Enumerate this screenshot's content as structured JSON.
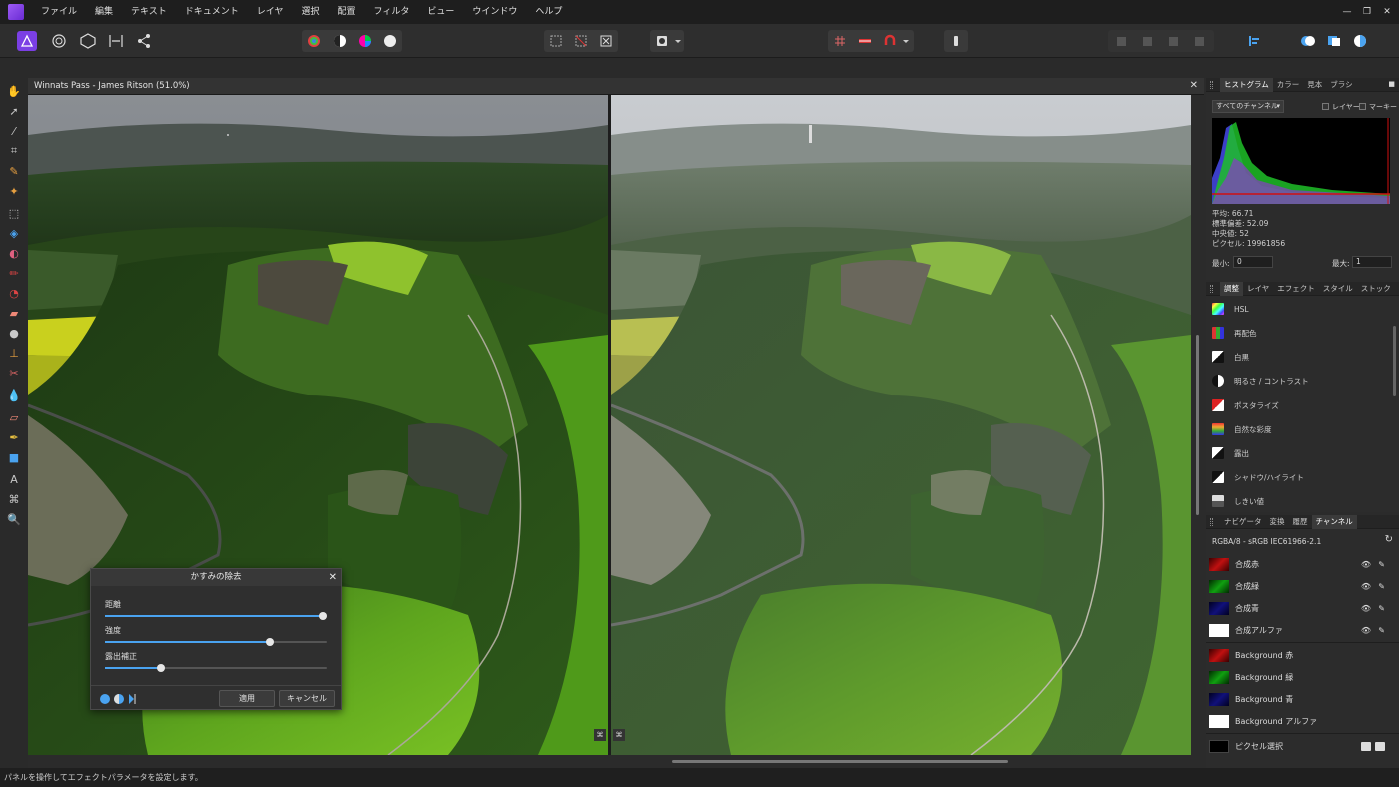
{
  "menubar": {
    "items": [
      "ファイル",
      "編集",
      "テキスト",
      "ドキュメント",
      "レイヤ",
      "選択",
      "配置",
      "フィルタ",
      "ビュー",
      "ウインドウ",
      "ヘルプ"
    ]
  },
  "document": {
    "title": "Winnats Pass - James Ritson (51.0%)"
  },
  "dialog": {
    "title": "かすみの除去",
    "sliders": [
      {
        "label": "距離",
        "value": 1.0
      },
      {
        "label": "強度",
        "value": 0.75
      },
      {
        "label": "露出補正",
        "value": 0.25
      }
    ],
    "apply": "適用",
    "cancel": "キャンセル"
  },
  "histogram": {
    "tabs": [
      "ヒストグラム",
      "カラー",
      "見本",
      "ブラシ"
    ],
    "channel_select": "すべてのチャンネル",
    "layer_check": "レイヤー",
    "marquee_check": "マーキー",
    "stats": [
      "平均: 66.71",
      "標準偏差: 52.09",
      "中央値: 52",
      "ピクセル: 19961856"
    ],
    "min_label": "最小:",
    "min_value": "0",
    "max_label": "最大:",
    "max_value": "1"
  },
  "adjustments": {
    "tabs": [
      "調整",
      "レイヤ",
      "エフェクト",
      "スタイル",
      "ストック"
    ],
    "items": [
      "HSL",
      "再配色",
      "白黒",
      "明るさ / コントラスト",
      "ポスタライズ",
      "自然な彩度",
      "露出",
      "シャドウ/ハイライト",
      "しきい値"
    ]
  },
  "channels": {
    "tabs": [
      "ナビゲータ",
      "変換",
      "履歴",
      "チャンネル"
    ],
    "format": "RGBA/8 - sRGB IEC61966-2.1",
    "composite": [
      "合成赤",
      "合成緑",
      "合成青",
      "合成アルファ"
    ],
    "background": [
      "Background 赤",
      "Background 緑",
      "Background 青",
      "Background アルファ"
    ],
    "pixel_selection": "ピクセル選択"
  },
  "status_bar": {
    "text": "パネルを操作してエフェクトパラメータを設定します。"
  },
  "colors": {
    "accent": "#4aa3f0",
    "brand": "#7b3fe4"
  }
}
